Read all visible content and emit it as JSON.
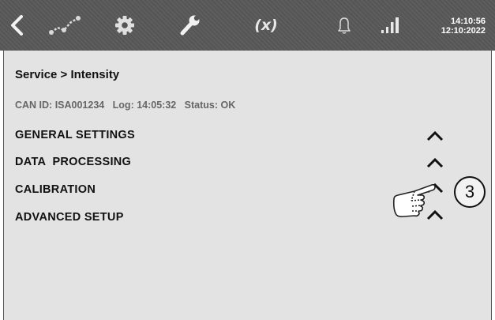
{
  "header": {
    "time": "14:10:56",
    "date": "12:10:2022",
    "fx_label": "(x)",
    "icons": [
      "back-icon",
      "trend-chart-icon",
      "gear-icon",
      "wrench-icon",
      "variable-fx-icon",
      "bell-icon",
      "signal-bars-icon"
    ]
  },
  "breadcrumb": "Service > Intensity",
  "info_line": "CAN ID: ISA001234   Log: 14:05:32   Status: OK",
  "sections": [
    {
      "label": "GENERAL SETTINGS",
      "state": "expanded"
    },
    {
      "label": "DATA  PROCESSING",
      "state": "expanded"
    },
    {
      "label": "CALIBRATION",
      "state": "expanded"
    },
    {
      "label": "ADVANCED SETUP",
      "state": "expanded"
    }
  ],
  "annotation": {
    "step_number": "3",
    "pointer_icon": "hand-pointer-icon"
  },
  "colors": {
    "topbar": "#555555",
    "content_background": "#e3e3e3",
    "icon": "#e8e8e8"
  }
}
